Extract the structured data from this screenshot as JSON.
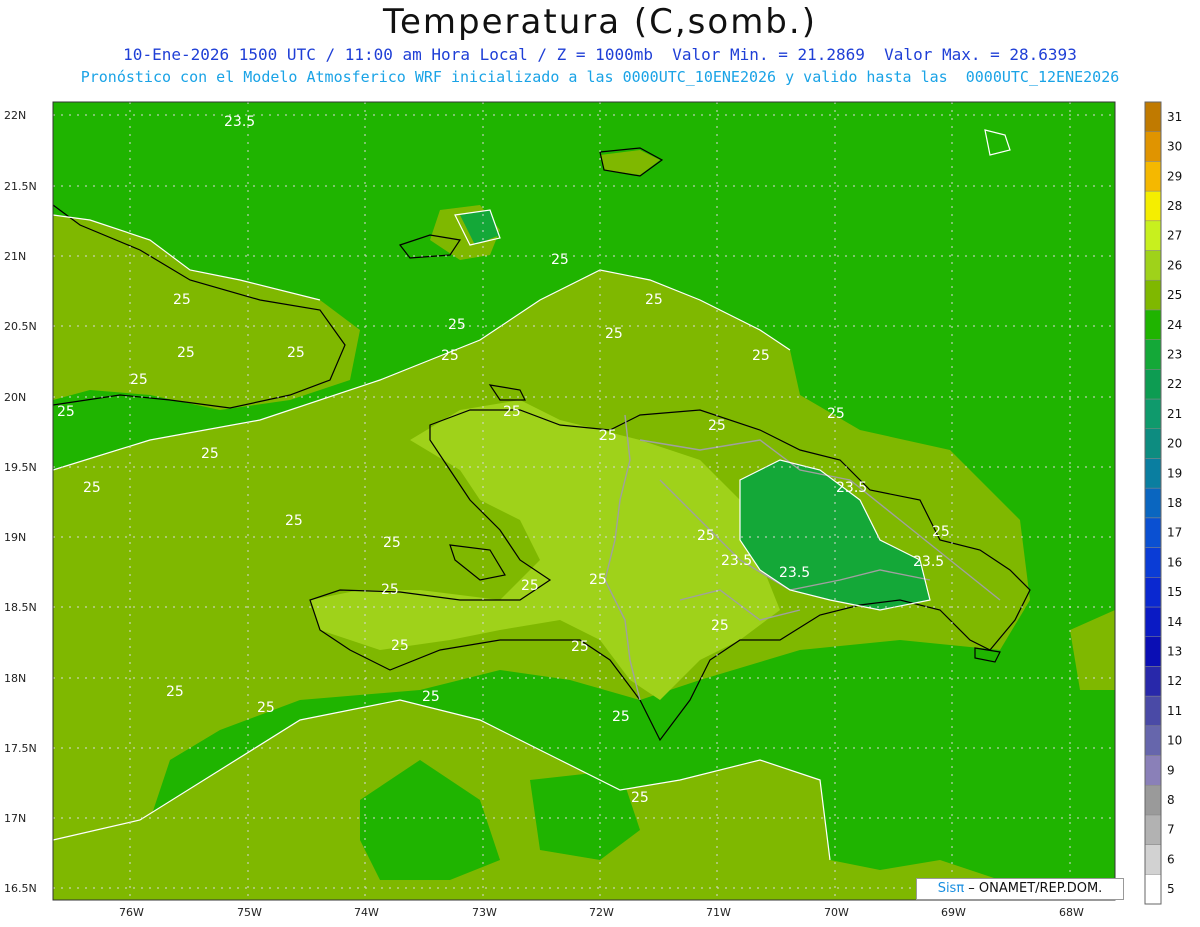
{
  "header": {
    "title": "Temperatura (C,somb.)",
    "line1": "10-Ene-2026 1500 UTC / 11:00 am Hora Local / Z = 1000mb  Valor Min. = 21.2869  Valor Max. = 28.6393",
    "line2": "Pronóstico con el Modelo Atmosferico WRF inicializado a las 0000UTC_10ENE2026 y valido hasta las  0000UTC_12ENE2026"
  },
  "axes": {
    "lat_labels": [
      "22N",
      "21.5N",
      "21N",
      "20.5N",
      "20N",
      "19.5N",
      "19N",
      "18.5N",
      "18N",
      "17.5N",
      "17N",
      "16.5N"
    ],
    "lon_labels": [
      "76W",
      "75W",
      "74W",
      "73W",
      "72W",
      "71W",
      "70W",
      "69W",
      "68W"
    ]
  },
  "contour_labels": [
    "23.5",
    "25",
    "25",
    "25",
    "25",
    "25",
    "25",
    "25",
    "25",
    "25",
    "25",
    "25",
    "25",
    "25",
    "25",
    "25",
    "25",
    "25",
    "25",
    "23.5",
    "23.5",
    "23.5",
    "23.5",
    "25",
    "25",
    "25",
    "25",
    "25",
    "25",
    "25",
    "25",
    "25",
    "25",
    "25",
    "25",
    "25",
    "25"
  ],
  "colorbar": {
    "levels": [
      "31",
      "30",
      "29",
      "28",
      "27",
      "26",
      "25",
      "24",
      "23",
      "22",
      "21",
      "20",
      "19",
      "18",
      "17",
      "16",
      "15",
      "14",
      "13",
      "12",
      "11",
      "10",
      "9",
      "8",
      "7",
      "6",
      "5"
    ],
    "colors": [
      "#c07a00",
      "#e09400",
      "#f5b800",
      "#f5ee00",
      "#c8f01e",
      "#9fd21a",
      "#7fb800",
      "#1fb400",
      "#14a838",
      "#0d9c52",
      "#0f9a6c",
      "#0d8c80",
      "#0a7ea0",
      "#0a66c0",
      "#0a50d2",
      "#0a3cd6",
      "#0a28d0",
      "#0a1ac4",
      "#0a0eb4",
      "#2828aa",
      "#4a4aa6",
      "#6666ac",
      "#8a80b8",
      "#9a9a9a",
      "#b2b2b2",
      "#d2d2d2",
      "#ffffff"
    ]
  },
  "credit": {
    "brand": "Sisπ",
    "text": " – ONAMET/REP.DOM."
  },
  "colors": {
    "base_green": "#1fb400",
    "mid_green": "#7fb800",
    "warm_green": "#9fd21a",
    "cool_green": "#14a838",
    "coast": "#000000",
    "border": "#a0a0a0"
  }
}
